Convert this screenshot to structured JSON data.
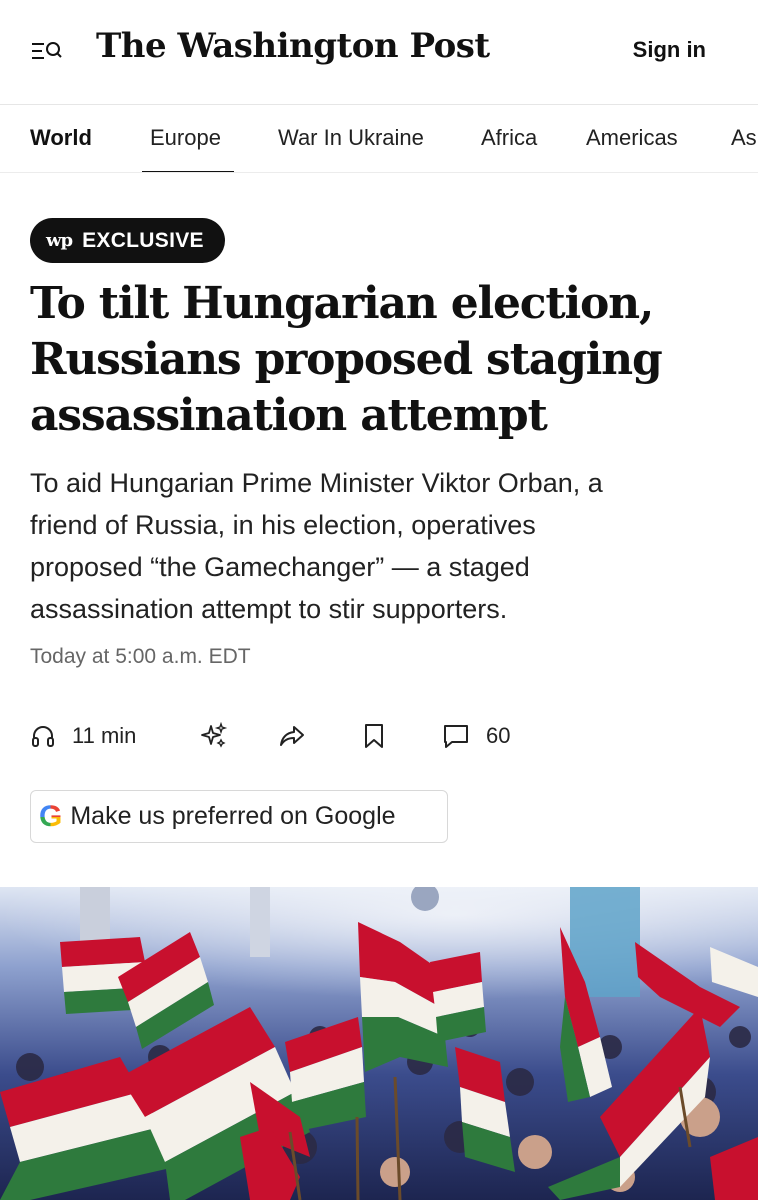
{
  "header": {
    "logo": "The Washington Post",
    "sign_in": "Sign in",
    "menu_icon": "menu-search-icon"
  },
  "nav": {
    "tabs": [
      "World",
      "Europe",
      "War In Ukraine",
      "Africa",
      "Americas",
      "As"
    ],
    "active": "Europe"
  },
  "article": {
    "badge_logo": "wp",
    "badge": "EXCLUSIVE",
    "headline": "To tilt Hungarian election, Russians proposed staging assassination attempt",
    "headline_lines": [
      "To tilt Hungarian election,",
      "Russians proposed staging",
      "assassination attempt"
    ],
    "dek_lines": [
      "To aid Hungarian Prime Minister Viktor Orban, a",
      "friend of Russia, in his election, operatives",
      "proposed “the Gamechanger” — a staged",
      "assassination attempt to stir supporters."
    ],
    "timestamp": "Today at 5:00 a.m. EDT"
  },
  "actions": {
    "listen_label": "11 min",
    "comments_count": "60",
    "icons": [
      "headphones-icon",
      "sparkle-icon",
      "share-icon",
      "bookmark-icon",
      "comment-icon"
    ]
  },
  "google_pref": {
    "g": "G",
    "label": "Make us preferred on Google"
  },
  "hero": {
    "description_icon": "photo-hungarian-flags-rally"
  },
  "colors": {
    "flag_red": "#c8102e",
    "flag_white": "#f4f1ea",
    "flag_green": "#2e7a3d",
    "hall_blue": "#2a3a78"
  }
}
